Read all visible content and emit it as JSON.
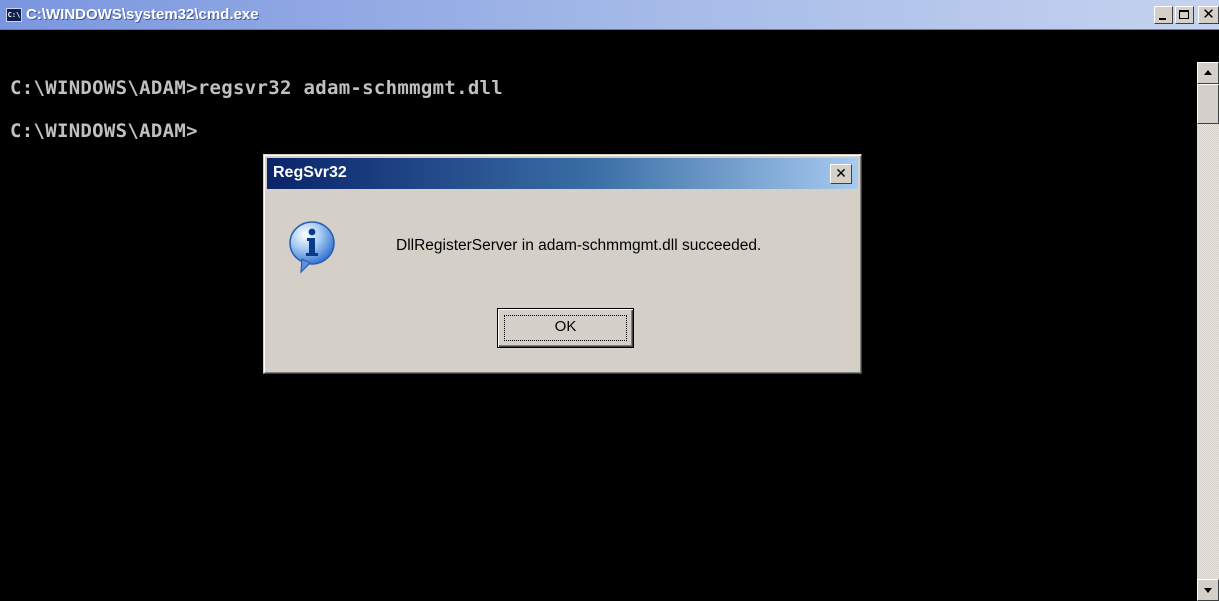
{
  "console": {
    "title": "C:\\WINDOWS\\system32\\cmd.exe",
    "icon_label": "C:\\",
    "lines": [
      "C:\\WINDOWS\\ADAM>regsvr32 adam-schmmgmt.dll",
      "C:\\WINDOWS\\ADAM>"
    ]
  },
  "dialog": {
    "title": "RegSvr32",
    "message": "DllRegisterServer in adam-schmmgmt.dll succeeded.",
    "ok_label": "OK",
    "icon": "information-icon"
  },
  "colors": {
    "console_bg": "#000000",
    "console_text": "#c0c0c0",
    "dialog_face": "#d4d0c8",
    "dialog_title_start": "#0a246a",
    "dialog_title_end": "#a6caf0"
  }
}
